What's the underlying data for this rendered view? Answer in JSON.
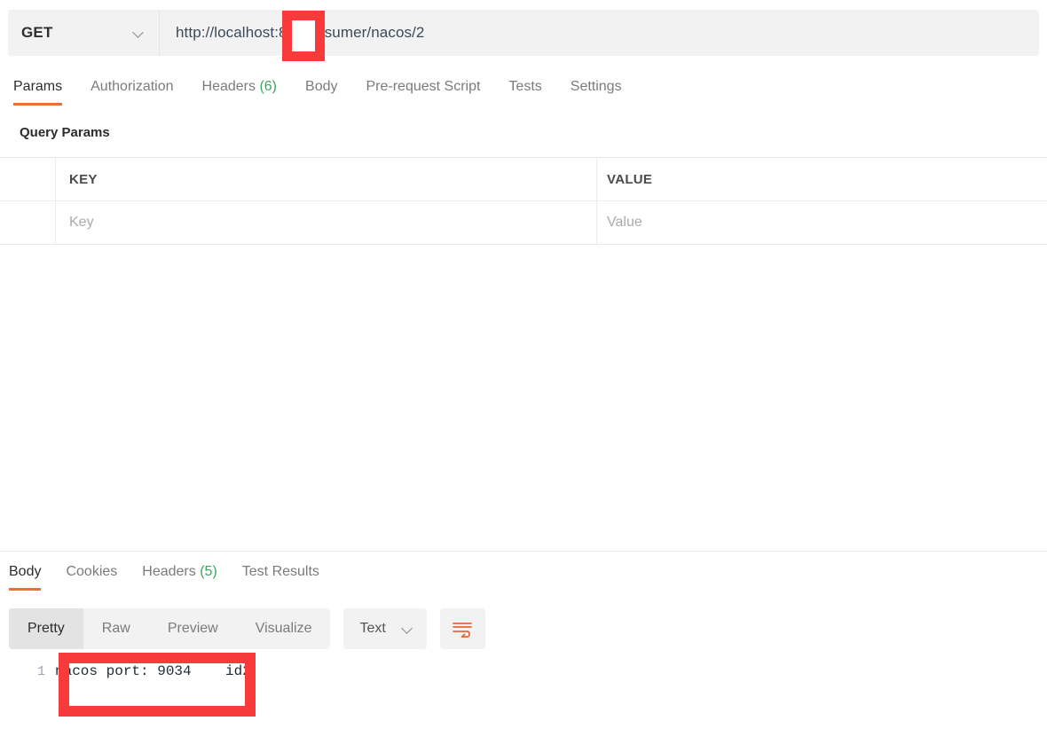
{
  "request": {
    "method": "GET",
    "method_dropdown_icon": "chevron-down-icon",
    "url": "http://localhost:81/consumer/nacos/2",
    "url_fragment_before": "http://localhos",
    "url_fragment_highlighted": ":81/",
    "url_fragment_after": "consumer/nacos/2",
    "tabs": [
      {
        "label": "Params",
        "active": true,
        "count": ""
      },
      {
        "label": "Authorization",
        "active": false,
        "count": ""
      },
      {
        "label": "Headers",
        "active": false,
        "count": "(6)"
      },
      {
        "label": "Body",
        "active": false,
        "count": ""
      },
      {
        "label": "Pre-request Script",
        "active": false,
        "count": ""
      },
      {
        "label": "Tests",
        "active": false,
        "count": ""
      },
      {
        "label": "Settings",
        "active": false,
        "count": ""
      }
    ]
  },
  "query_params": {
    "section_title": "Query Params",
    "headers": {
      "key": "KEY",
      "value": "VALUE"
    },
    "rows": [
      {
        "key_placeholder": "Key",
        "value_placeholder": "Value"
      }
    ]
  },
  "response": {
    "tabs": [
      {
        "label": "Body",
        "active": true,
        "count": ""
      },
      {
        "label": "Cookies",
        "active": false,
        "count": ""
      },
      {
        "label": "Headers",
        "active": false,
        "count": "(5)"
      },
      {
        "label": "Test Results",
        "active": false,
        "count": ""
      }
    ],
    "view_modes": [
      {
        "label": "Pretty",
        "active": true
      },
      {
        "label": "Raw",
        "active": false
      },
      {
        "label": "Preview",
        "active": false
      },
      {
        "label": "Visualize",
        "active": false
      }
    ],
    "content_type": "Text",
    "content_type_icon": "chevron-down-icon",
    "wrap_icon": "word-wrap-icon",
    "body": {
      "line_number": "1",
      "text_highlighted": "nacos port: 9034",
      "text_trailing": "id2",
      "full_text": "nacos port: 9034    id2"
    }
  },
  "annotations": {
    "url_box_color": "#f93a3a",
    "body_box_color": "#f93a3a",
    "accent_color": "#f26b3a",
    "count_color": "#3ba55d"
  }
}
